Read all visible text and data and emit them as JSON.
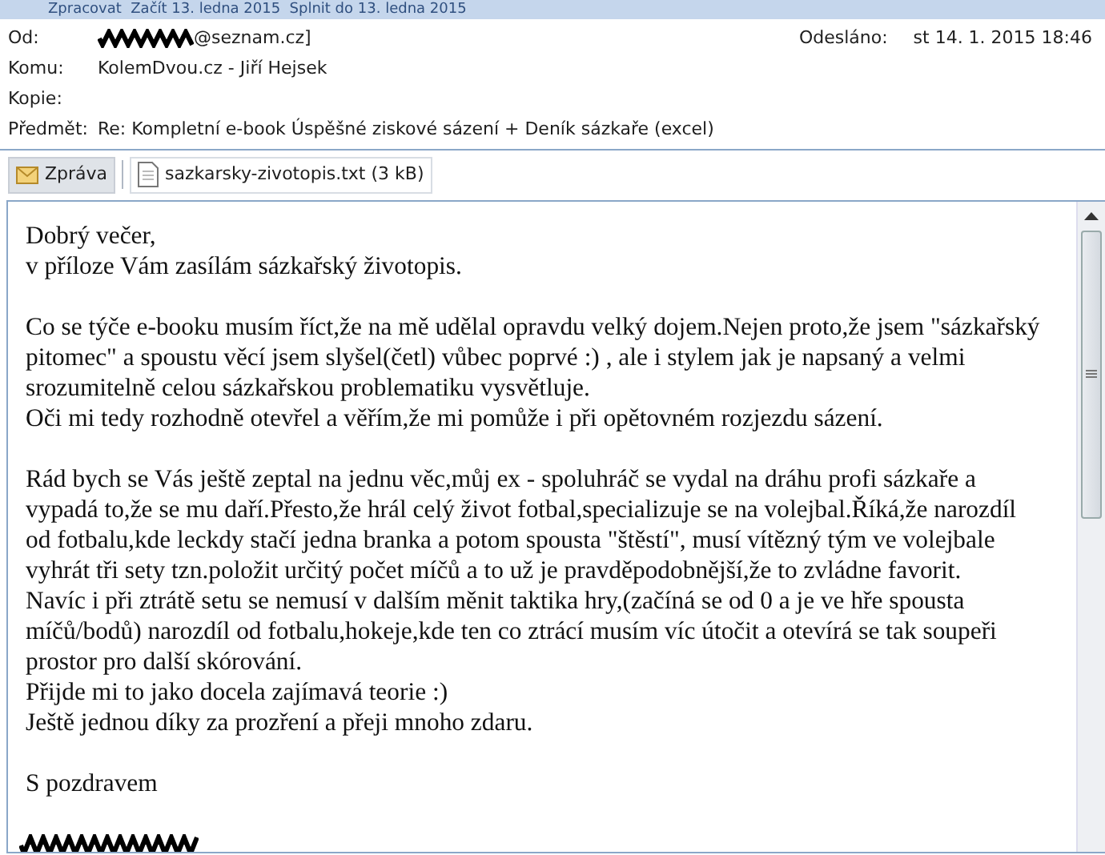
{
  "info_bar": {
    "text": "Zpracovat  Začít 13. ledna 2015  Splnit do 13. ledna 2015"
  },
  "header": {
    "fields": [
      {
        "label": "Od:",
        "value": "@seznam.cz]",
        "redacted": true
      },
      {
        "label": "Komu:",
        "value": "KolemDvou.cz - Jiří Hejsek"
      },
      {
        "label": "Kopie:"
      },
      {
        "label": "Předmět:",
        "value": "Re: Kompletní e-book Úspěšné ziskové sázení + Deník sázkaře (excel)"
      }
    ],
    "sent_label": "Odesláno:",
    "sent_value": "st 14. 1. 2015 18:46"
  },
  "tabs": [
    {
      "label": "Zpráva",
      "kind": "message",
      "selected": true
    },
    {
      "label": "sazkarsky-zivotopis.txt (3 kB)",
      "kind": "file",
      "selected": false
    }
  ],
  "body": {
    "paragraphs": [
      [
        "Dobrý večer,",
        "v příloze Vám zasílám sázkařský životopis."
      ],
      [
        "Co se týče e-booku musím říct,že na mě udělal opravdu velký dojem.Nejen proto,že jsem \"sázkařský pitomec\" a spoustu věcí jsem slyšel(četl) vůbec poprvé :) , ale i stylem jak je napsaný a velmi srozumitelně celou sázkařskou problematiku vysvětluje.",
        "Oči mi tedy rozhodně otevřel a věřím,že mi pomůže i při opětovném rozjezdu sázení."
      ],
      [
        "Rád bych se Vás ještě zeptal na jednu věc,můj ex - spoluhráč se vydal na dráhu profi sázkaře a vypadá to,že se mu daří.Přesto,že hrál celý život fotbal,specializuje se na volejbal.Říká,že narozdíl od fotbalu,kde leckdy stačí jedna branka a potom spousta \"štěstí\", musí vítězný tým ve volejbale vyhrát tři sety tzn.položit určitý počet míčů a to už je pravděpodobnější,že to zvládne favorit.",
        "Navíc i při ztrátě setu se nemusí v dalším měnit taktika hry,(začíná se od 0 a je ve hře spousta míčů/bodů) narozdíl od fotbalu,hokeje,kde ten co ztrácí musím víc útočit a otevírá se tak soupeři prostor pro další skórování.",
        "Přijde mi to jako docela zajímavá teorie :)",
        "Ještě jednou díky za prozření a přeji mnoho zdaru."
      ],
      [
        "S pozdravem"
      ]
    ],
    "signature_redacted": true
  }
}
